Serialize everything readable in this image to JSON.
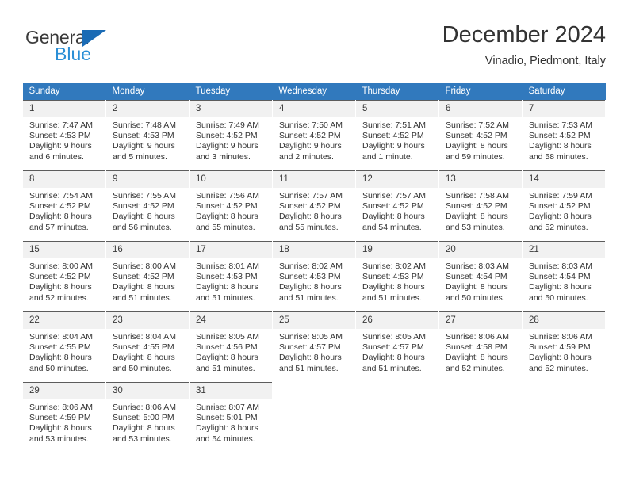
{
  "brand": {
    "name_top": "General",
    "name_bottom": "Blue",
    "accent_color": "#1a6bb5",
    "accent_color_light": "#2b8fd6"
  },
  "header": {
    "title": "December 2024",
    "subtitle": "Vinadio, Piedmont, Italy"
  },
  "calendar": {
    "header_bg": "#3179bd",
    "daynum_bg": "#f1f1f1",
    "weekday_headers": [
      "Sunday",
      "Monday",
      "Tuesday",
      "Wednesday",
      "Thursday",
      "Friday",
      "Saturday"
    ],
    "weeks": [
      [
        {
          "day": "1",
          "sunrise": "Sunrise: 7:47 AM",
          "sunset": "Sunset: 4:53 PM",
          "daylight1": "Daylight: 9 hours",
          "daylight2": "and 6 minutes."
        },
        {
          "day": "2",
          "sunrise": "Sunrise: 7:48 AM",
          "sunset": "Sunset: 4:53 PM",
          "daylight1": "Daylight: 9 hours",
          "daylight2": "and 5 minutes."
        },
        {
          "day": "3",
          "sunrise": "Sunrise: 7:49 AM",
          "sunset": "Sunset: 4:52 PM",
          "daylight1": "Daylight: 9 hours",
          "daylight2": "and 3 minutes."
        },
        {
          "day": "4",
          "sunrise": "Sunrise: 7:50 AM",
          "sunset": "Sunset: 4:52 PM",
          "daylight1": "Daylight: 9 hours",
          "daylight2": "and 2 minutes."
        },
        {
          "day": "5",
          "sunrise": "Sunrise: 7:51 AM",
          "sunset": "Sunset: 4:52 PM",
          "daylight1": "Daylight: 9 hours",
          "daylight2": "and 1 minute."
        },
        {
          "day": "6",
          "sunrise": "Sunrise: 7:52 AM",
          "sunset": "Sunset: 4:52 PM",
          "daylight1": "Daylight: 8 hours",
          "daylight2": "and 59 minutes."
        },
        {
          "day": "7",
          "sunrise": "Sunrise: 7:53 AM",
          "sunset": "Sunset: 4:52 PM",
          "daylight1": "Daylight: 8 hours",
          "daylight2": "and 58 minutes."
        }
      ],
      [
        {
          "day": "8",
          "sunrise": "Sunrise: 7:54 AM",
          "sunset": "Sunset: 4:52 PM",
          "daylight1": "Daylight: 8 hours",
          "daylight2": "and 57 minutes."
        },
        {
          "day": "9",
          "sunrise": "Sunrise: 7:55 AM",
          "sunset": "Sunset: 4:52 PM",
          "daylight1": "Daylight: 8 hours",
          "daylight2": "and 56 minutes."
        },
        {
          "day": "10",
          "sunrise": "Sunrise: 7:56 AM",
          "sunset": "Sunset: 4:52 PM",
          "daylight1": "Daylight: 8 hours",
          "daylight2": "and 55 minutes."
        },
        {
          "day": "11",
          "sunrise": "Sunrise: 7:57 AM",
          "sunset": "Sunset: 4:52 PM",
          "daylight1": "Daylight: 8 hours",
          "daylight2": "and 55 minutes."
        },
        {
          "day": "12",
          "sunrise": "Sunrise: 7:57 AM",
          "sunset": "Sunset: 4:52 PM",
          "daylight1": "Daylight: 8 hours",
          "daylight2": "and 54 minutes."
        },
        {
          "day": "13",
          "sunrise": "Sunrise: 7:58 AM",
          "sunset": "Sunset: 4:52 PM",
          "daylight1": "Daylight: 8 hours",
          "daylight2": "and 53 minutes."
        },
        {
          "day": "14",
          "sunrise": "Sunrise: 7:59 AM",
          "sunset": "Sunset: 4:52 PM",
          "daylight1": "Daylight: 8 hours",
          "daylight2": "and 52 minutes."
        }
      ],
      [
        {
          "day": "15",
          "sunrise": "Sunrise: 8:00 AM",
          "sunset": "Sunset: 4:52 PM",
          "daylight1": "Daylight: 8 hours",
          "daylight2": "and 52 minutes."
        },
        {
          "day": "16",
          "sunrise": "Sunrise: 8:00 AM",
          "sunset": "Sunset: 4:52 PM",
          "daylight1": "Daylight: 8 hours",
          "daylight2": "and 51 minutes."
        },
        {
          "day": "17",
          "sunrise": "Sunrise: 8:01 AM",
          "sunset": "Sunset: 4:53 PM",
          "daylight1": "Daylight: 8 hours",
          "daylight2": "and 51 minutes."
        },
        {
          "day": "18",
          "sunrise": "Sunrise: 8:02 AM",
          "sunset": "Sunset: 4:53 PM",
          "daylight1": "Daylight: 8 hours",
          "daylight2": "and 51 minutes."
        },
        {
          "day": "19",
          "sunrise": "Sunrise: 8:02 AM",
          "sunset": "Sunset: 4:53 PM",
          "daylight1": "Daylight: 8 hours",
          "daylight2": "and 51 minutes."
        },
        {
          "day": "20",
          "sunrise": "Sunrise: 8:03 AM",
          "sunset": "Sunset: 4:54 PM",
          "daylight1": "Daylight: 8 hours",
          "daylight2": "and 50 minutes."
        },
        {
          "day": "21",
          "sunrise": "Sunrise: 8:03 AM",
          "sunset": "Sunset: 4:54 PM",
          "daylight1": "Daylight: 8 hours",
          "daylight2": "and 50 minutes."
        }
      ],
      [
        {
          "day": "22",
          "sunrise": "Sunrise: 8:04 AM",
          "sunset": "Sunset: 4:55 PM",
          "daylight1": "Daylight: 8 hours",
          "daylight2": "and 50 minutes."
        },
        {
          "day": "23",
          "sunrise": "Sunrise: 8:04 AM",
          "sunset": "Sunset: 4:55 PM",
          "daylight1": "Daylight: 8 hours",
          "daylight2": "and 50 minutes."
        },
        {
          "day": "24",
          "sunrise": "Sunrise: 8:05 AM",
          "sunset": "Sunset: 4:56 PM",
          "daylight1": "Daylight: 8 hours",
          "daylight2": "and 51 minutes."
        },
        {
          "day": "25",
          "sunrise": "Sunrise: 8:05 AM",
          "sunset": "Sunset: 4:57 PM",
          "daylight1": "Daylight: 8 hours",
          "daylight2": "and 51 minutes."
        },
        {
          "day": "26",
          "sunrise": "Sunrise: 8:05 AM",
          "sunset": "Sunset: 4:57 PM",
          "daylight1": "Daylight: 8 hours",
          "daylight2": "and 51 minutes."
        },
        {
          "day": "27",
          "sunrise": "Sunrise: 8:06 AM",
          "sunset": "Sunset: 4:58 PM",
          "daylight1": "Daylight: 8 hours",
          "daylight2": "and 52 minutes."
        },
        {
          "day": "28",
          "sunrise": "Sunrise: 8:06 AM",
          "sunset": "Sunset: 4:59 PM",
          "daylight1": "Daylight: 8 hours",
          "daylight2": "and 52 minutes."
        }
      ],
      [
        {
          "day": "29",
          "sunrise": "Sunrise: 8:06 AM",
          "sunset": "Sunset: 4:59 PM",
          "daylight1": "Daylight: 8 hours",
          "daylight2": "and 53 minutes."
        },
        {
          "day": "30",
          "sunrise": "Sunrise: 8:06 AM",
          "sunset": "Sunset: 5:00 PM",
          "daylight1": "Daylight: 8 hours",
          "daylight2": "and 53 minutes."
        },
        {
          "day": "31",
          "sunrise": "Sunrise: 8:07 AM",
          "sunset": "Sunset: 5:01 PM",
          "daylight1": "Daylight: 8 hours",
          "daylight2": "and 54 minutes."
        },
        {
          "day": "",
          "sunrise": "",
          "sunset": "",
          "daylight1": "",
          "daylight2": ""
        },
        {
          "day": "",
          "sunrise": "",
          "sunset": "",
          "daylight1": "",
          "daylight2": ""
        },
        {
          "day": "",
          "sunrise": "",
          "sunset": "",
          "daylight1": "",
          "daylight2": ""
        },
        {
          "day": "",
          "sunrise": "",
          "sunset": "",
          "daylight1": "",
          "daylight2": ""
        }
      ]
    ]
  }
}
